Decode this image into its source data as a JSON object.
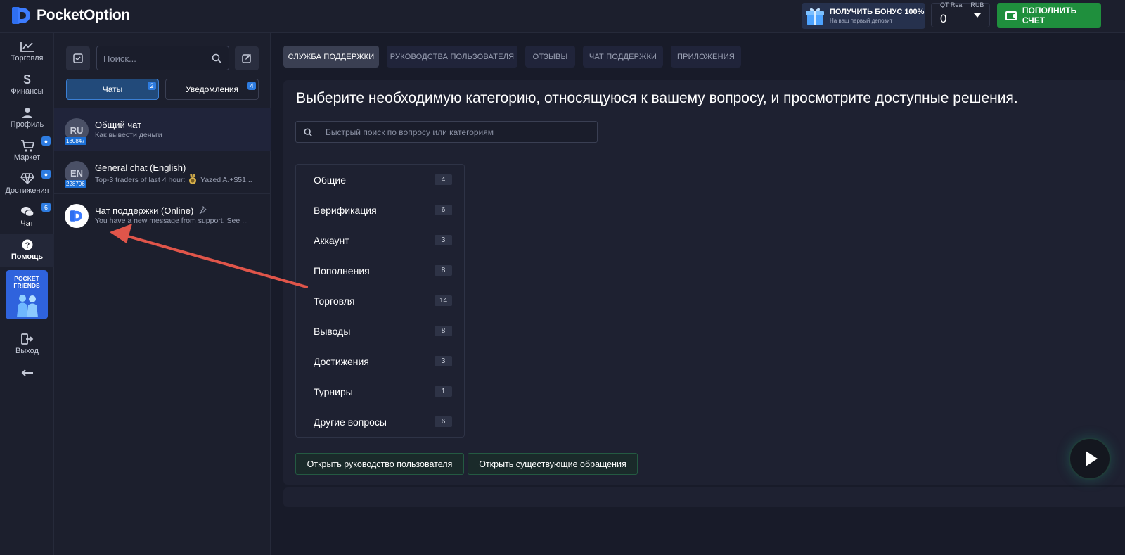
{
  "brand": {
    "name": "PocketOption"
  },
  "bonus": {
    "title": "ПОЛУЧИТЬ БОНУС 100%",
    "subtitle": "На ваш первый депозит"
  },
  "account": {
    "type": "QT Real",
    "currency": "RUB",
    "balance": "0"
  },
  "deposit_label": "ПОПОЛНИТЬ СЧЕТ",
  "nav": [
    {
      "label": "Торговля",
      "icon": "chart-line-icon"
    },
    {
      "label": "Финансы",
      "icon": "dollar-icon"
    },
    {
      "label": "Профиль",
      "icon": "user-icon"
    },
    {
      "label": "Маркет",
      "icon": "cart-icon",
      "badge": "bell"
    },
    {
      "label": "Достижения",
      "icon": "diamond-icon",
      "badge": "bell"
    },
    {
      "label": "Чат",
      "icon": "chat-icon",
      "badge": "6"
    },
    {
      "label": "Помощь",
      "icon": "help-icon",
      "active": true
    }
  ],
  "friends": {
    "line1": "POCKET",
    "line2": "FRIENDS"
  },
  "logout_label": "Выход",
  "chat_panel": {
    "search_placeholder": "Поиск...",
    "tabs": [
      {
        "label": "Чаты",
        "badge": "2"
      },
      {
        "label": "Уведомления",
        "badge": "4"
      }
    ],
    "items": [
      {
        "avatar": "RU",
        "count": "180847",
        "title": "Общий чат",
        "subtitle": "Как вывести деньги"
      },
      {
        "avatar": "EN",
        "count": "228706",
        "title": "General chat (English)",
        "subtitle": "Top-3 traders of last 4 hour:",
        "subtitle2": "Yazed A.+$51..."
      },
      {
        "avatar": "",
        "count": "",
        "title": "Чат поддержки (Online)",
        "subtitle": "You have a new message from support. See ..."
      }
    ]
  },
  "tabs": [
    {
      "label": "СЛУЖБА ПОДДЕРЖКИ",
      "active": true
    },
    {
      "label": "РУКОВОДСТВА ПОЛЬЗОВАТЕЛЯ"
    },
    {
      "label": "ОТЗЫВЫ"
    },
    {
      "label": "ЧАТ ПОДДЕРЖКИ"
    },
    {
      "label": "ПРИЛОЖЕНИЯ"
    }
  ],
  "support": {
    "heading": "Выберите необходимую категорию, относящуюся к вашему вопросу, и просмотрите доступные решения.",
    "search_placeholder": "Быстрый поиск по вопросу или категориям",
    "categories": [
      {
        "name": "Общие",
        "count": "4"
      },
      {
        "name": "Верификация",
        "count": "6"
      },
      {
        "name": "Аккаунт",
        "count": "3"
      },
      {
        "name": "Пополнения",
        "count": "8"
      },
      {
        "name": "Торговля",
        "count": "14"
      },
      {
        "name": "Выводы",
        "count": "8"
      },
      {
        "name": "Достижения",
        "count": "3"
      },
      {
        "name": "Турниры",
        "count": "1"
      },
      {
        "name": "Другие вопросы",
        "count": "6"
      }
    ],
    "open_guide_label": "Открыть руководство пользователя",
    "open_tickets_label": "Открыть существующие обращения"
  },
  "colors": {
    "accent_blue": "#2e7ce0",
    "deposit_green": "#1f8f3d",
    "annotation_red": "#e0554a"
  }
}
